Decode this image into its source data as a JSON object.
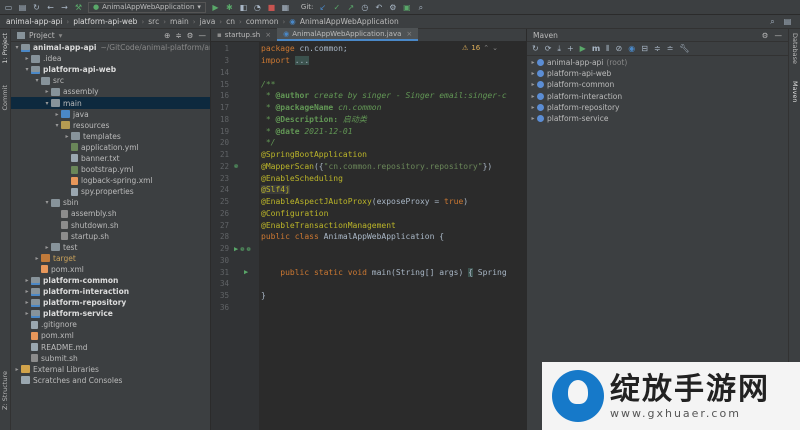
{
  "toolbar": {
    "run_config": "AnimalAppWebApplication",
    "git_label": "Git:",
    "icons": [
      "folder-icon",
      "save-icon",
      "sync-icon",
      "back-icon",
      "forward-icon",
      "hammer-icon",
      "run-icon",
      "debug-icon",
      "coverage-icon",
      "profile-icon",
      "stop-icon",
      "git-update-icon",
      "git-commit-icon",
      "git-push-icon",
      "history-icon",
      "rollback-icon",
      "settings-icon",
      "plugin-icon",
      "search-icon"
    ]
  },
  "breadcrumb": [
    "animal-app-api",
    "platform-api-web",
    "src",
    "main",
    "java",
    "cn",
    "common",
    "AnimalAppWebApplication"
  ],
  "left_stripe": {
    "project_tab": "1: Project",
    "commit_tab": "Commit",
    "structure_tab": "Z: Structure"
  },
  "project_panel": {
    "title": "Project",
    "tree": [
      {
        "label": "animal-app-api",
        "extra": "~/GitCode/animal-platform/ani",
        "level": 0,
        "arrow": "▾",
        "icon": "module",
        "bold": true
      },
      {
        "label": ".idea",
        "level": 1,
        "arrow": "▸",
        "icon": "folder"
      },
      {
        "label": "platform-api-web",
        "level": 1,
        "arrow": "▾",
        "icon": "module",
        "bold": true
      },
      {
        "label": "src",
        "level": 2,
        "arrow": "▾",
        "icon": "folder"
      },
      {
        "label": "assembly",
        "level": 3,
        "arrow": "▸",
        "icon": "folder"
      },
      {
        "label": "main",
        "level": 3,
        "arrow": "▾",
        "icon": "folder",
        "selected": true
      },
      {
        "label": "java",
        "level": 4,
        "arrow": "▸",
        "icon": "src"
      },
      {
        "label": "resources",
        "level": 4,
        "arrow": "▾",
        "icon": "res"
      },
      {
        "label": "templates",
        "level": 5,
        "arrow": "▸",
        "icon": "folder"
      },
      {
        "label": "application.yml",
        "level": 5,
        "arrow": "",
        "icon": "yml"
      },
      {
        "label": "banner.txt",
        "level": 5,
        "arrow": "",
        "icon": "file"
      },
      {
        "label": "bootstrap.yml",
        "level": 5,
        "arrow": "",
        "icon": "yml"
      },
      {
        "label": "logback-spring.xml",
        "level": 5,
        "arrow": "",
        "icon": "xml"
      },
      {
        "label": "spy.properties",
        "level": 5,
        "arrow": "",
        "icon": "file"
      },
      {
        "label": "sbin",
        "level": 3,
        "arrow": "▾",
        "icon": "folder"
      },
      {
        "label": "assembly.sh",
        "level": 4,
        "arrow": "",
        "icon": "sh"
      },
      {
        "label": "shutdown.sh",
        "level": 4,
        "arrow": "",
        "icon": "sh"
      },
      {
        "label": "startup.sh",
        "level": 4,
        "arrow": "",
        "icon": "sh"
      },
      {
        "label": "test",
        "level": 3,
        "arrow": "▸",
        "icon": "folder"
      },
      {
        "label": "target",
        "level": 2,
        "arrow": "▸",
        "icon": "excluded",
        "orange": true
      },
      {
        "label": "pom.xml",
        "level": 2,
        "arrow": "",
        "icon": "xml"
      },
      {
        "label": "platform-common",
        "level": 1,
        "arrow": "▸",
        "icon": "module",
        "bold": true
      },
      {
        "label": "platform-interaction",
        "level": 1,
        "arrow": "▸",
        "icon": "module",
        "bold": true
      },
      {
        "label": "platform-repository",
        "level": 1,
        "arrow": "▸",
        "icon": "module",
        "bold": true
      },
      {
        "label": "platform-service",
        "level": 1,
        "arrow": "▸",
        "icon": "module",
        "bold": true
      },
      {
        "label": ".gitignore",
        "level": 1,
        "arrow": "",
        "icon": "file"
      },
      {
        "label": "pom.xml",
        "level": 1,
        "arrow": "",
        "icon": "xml"
      },
      {
        "label": "README.md",
        "level": 1,
        "arrow": "",
        "icon": "file"
      },
      {
        "label": "submit.sh",
        "level": 1,
        "arrow": "",
        "icon": "sh"
      },
      {
        "label": "External Libraries",
        "level": 0,
        "arrow": "▸",
        "icon": "lib"
      },
      {
        "label": "Scratches and Consoles",
        "level": 0,
        "arrow": "",
        "icon": "scratch"
      }
    ]
  },
  "editor_tabs": [
    {
      "label": "startup.sh",
      "active": false
    },
    {
      "label": "AnimalAppWebApplication.java",
      "active": true
    }
  ],
  "editor": {
    "warning_count": "16",
    "lines": [
      {
        "n": "1",
        "mark": "",
        "html": "<span class='c-kw'>package</span> <span class='c-pkg'>cn.common</span>;"
      },
      {
        "n": "3",
        "mark": "",
        "html": "<span class='c-kw'>import</span> <span class='c-fold'>...</span>"
      },
      {
        "n": "14",
        "mark": "",
        "html": ""
      },
      {
        "n": "15",
        "mark": "",
        "html": "<span class='c-cmt'>/**</span>"
      },
      {
        "n": "16",
        "mark": "",
        "html": "<span class='c-cmt'> * </span><span class='c-doctag'>@author</span><span class='c-cmt'> create by singer - Singer email:singer-c</span>"
      },
      {
        "n": "17",
        "mark": "",
        "html": "<span class='c-cmt'> * </span><span class='c-doctag'>@packageName</span><span class='c-cmt'> cn.common</span>"
      },
      {
        "n": "18",
        "mark": "",
        "html": "<span class='c-cmt'> * </span><span class='c-doctag'>@Description:</span><span class='c-cmt'> 启动类</span>"
      },
      {
        "n": "19",
        "mark": "",
        "html": "<span class='c-cmt'> * </span><span class='c-doctag'>@date</span><span class='c-cmt'> 2021-12-01</span>"
      },
      {
        "n": "20",
        "mark": "",
        "html": "<span class='c-cmt'> */</span>"
      },
      {
        "n": "21",
        "mark": "",
        "html": "<span class='c-ann'>@SpringBootApplication</span>"
      },
      {
        "n": "22",
        "mark": "bean",
        "html": "<span class='c-ann'>@MapperScan</span>({<span class='c-str'>\"cn.common.repository.repository\"</span>})"
      },
      {
        "n": "23",
        "mark": "",
        "html": "<span class='c-ann'>@EnableScheduling</span>"
      },
      {
        "n": "24",
        "mark": "",
        "html": "<span class='c-ann c-hl'>@Slf4j</span>"
      },
      {
        "n": "25",
        "mark": "",
        "html": "<span class='c-ann'>@EnableAspectJAutoProxy</span>(exposeProxy = <span class='c-kw'>true</span>)"
      },
      {
        "n": "26",
        "mark": "",
        "html": "<span class='c-ann'>@Configuration</span>"
      },
      {
        "n": "27",
        "mark": "",
        "html": "<span class='c-ann'>@EnableTransactionManagement</span>"
      },
      {
        "n": "28",
        "mark": "",
        "html": "<span class='c-kw'>public class</span> <span class='c-cls'>AnimalAppWebApplication</span> {"
      },
      {
        "n": "29",
        "mark": "run",
        "html": ""
      },
      {
        "n": "30",
        "mark": "",
        "html": ""
      },
      {
        "n": "31",
        "mark": "run1",
        "html": "    <span class='c-kw'>public static void</span> main(String[] args) <span class='c-fold'>{</span> <span class='c-cls'>Spring</span>"
      },
      {
        "n": "34",
        "mark": "",
        "html": ""
      },
      {
        "n": "35",
        "mark": "",
        "html": "}"
      },
      {
        "n": "36",
        "mark": "",
        "html": ""
      }
    ]
  },
  "maven_panel": {
    "title": "Maven",
    "toolbar_icons": [
      "refresh-icon",
      "add-icon",
      "download-icon",
      "plus-icon",
      "run-icon",
      "execute-goal-icon",
      "toggle-offline-icon",
      "skip-tests-icon",
      "show-deps-icon",
      "collapse-icon",
      "expand-icon",
      "settings-icon"
    ],
    "root": {
      "label": "animal-app-api",
      "suffix": "(root)"
    },
    "modules": [
      "platform-api-web",
      "platform-common",
      "platform-interaction",
      "platform-repository",
      "platform-service"
    ]
  },
  "right_stripe": {
    "maven_tab": "Maven",
    "database_tab": "Database"
  },
  "watermark": {
    "brand_cn": "绽放手游网",
    "url": "www.gxhuaer.com"
  }
}
